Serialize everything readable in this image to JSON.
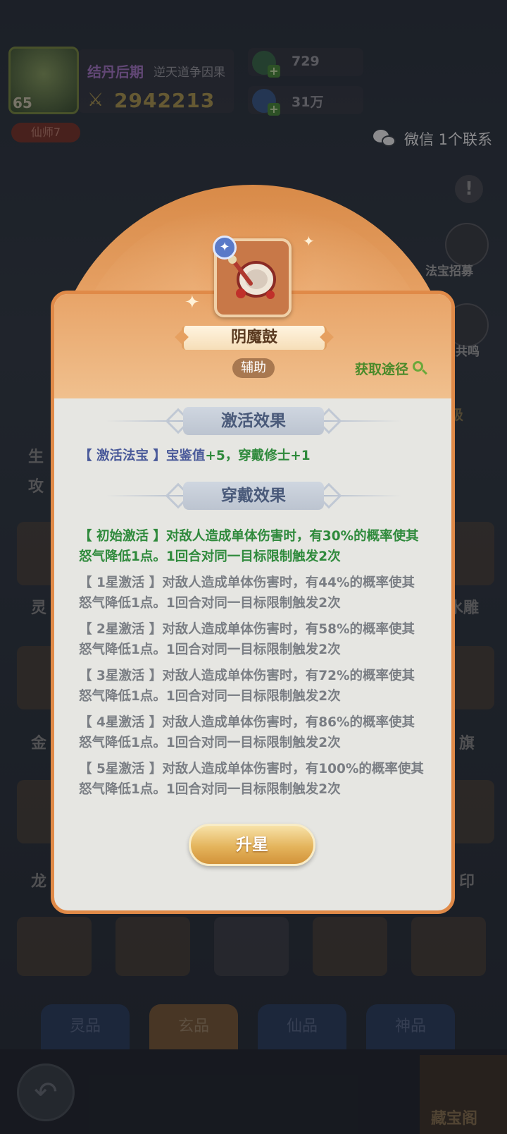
{
  "hud": {
    "level": "65",
    "realm": "结丹后期",
    "subtitle": "逆天道争因果",
    "power": "2942213",
    "rank": "仙师7",
    "resource1": "729",
    "resource2": "31万"
  },
  "notification": {
    "text": "微信 1个联系"
  },
  "side_menu": {
    "summon_label": "法宝招募",
    "resonance_label": "宝共鸣",
    "level_label": "级"
  },
  "background": {
    "stat_label_1": "生",
    "stat_label_2": "攻",
    "item_labels": [
      "灵",
      "水雕",
      "金",
      "旗",
      "龙",
      "印"
    ],
    "tabs": [
      "灵品",
      "玄品",
      "仙品",
      "神品"
    ],
    "selected_tab": "玄品",
    "treasury_label": "藏宝阁"
  },
  "modal": {
    "item_name": "阴魔鼓",
    "role": "辅助",
    "source_link": "获取途径",
    "activation_title": "激活效果",
    "activation_text": "【 激活法宝 】宝鉴值",
    "activation_value": "+5，穿戴修士+1",
    "wear_title": "穿戴效果",
    "effects": [
      {
        "line1": "【 初始激活 】对敌人造成单体伤害时，有30%的概率使其",
        "line2": "怒气降低1点。1回合对同一目标限制触发2次",
        "active": true
      },
      {
        "line1": "【 1星激活 】对敌人造成单体伤害时，有44%的概率使其",
        "line2": "怒气降低1点。1回合对同一目标限制触发2次",
        "active": false
      },
      {
        "line1": "【 2星激活 】对敌人造成单体伤害时，有58%的概率使其",
        "line2": "怒气降低1点。1回合对同一目标限制触发2次",
        "active": false
      },
      {
        "line1": "【 3星激活 】对敌人造成单体伤害时，有72%的概率使其",
        "line2": "怒气降低1点。1回合对同一目标限制触发2次",
        "active": false
      },
      {
        "line1": "【 4星激活 】对敌人造成单体伤害时，有86%的概率使其",
        "line2": "怒气降低1点。1回合对同一目标限制触发2次",
        "active": false
      },
      {
        "line1": "【 5星激活 】对敌人造成单体伤害时，有100%的概率使其",
        "line2": "怒气降低1点。1回合对同一目标限制触发2次",
        "active": false
      }
    ],
    "upgrade_button": "升星"
  },
  "colors": {
    "modal_border": "#e08a48",
    "active_effect": "#2f8a3c",
    "inactive_effect": "#7a7e84",
    "section_title": "#4a5a7a"
  }
}
